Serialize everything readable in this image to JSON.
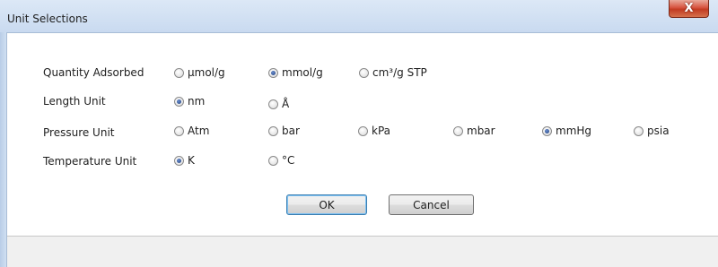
{
  "window": {
    "title": "Unit Selections",
    "close_glyph": "X"
  },
  "rows": [
    {
      "label": "Quantity Adsorbed",
      "options": [
        "μmol/g",
        "mmol/g",
        "cm³/g STP"
      ],
      "selected": 1
    },
    {
      "label": "Length Unit",
      "options": [
        "nm",
        "Å"
      ],
      "selected": 0
    },
    {
      "label": "Pressure Unit",
      "options": [
        "Atm",
        "bar",
        "kPa",
        "mbar",
        "mmHg",
        "psia"
      ],
      "selected": 4
    },
    {
      "label": "Temperature Unit",
      "options": [
        "K",
        "°C"
      ],
      "selected": 0
    }
  ],
  "buttons": {
    "ok": "OK",
    "cancel": "Cancel"
  }
}
